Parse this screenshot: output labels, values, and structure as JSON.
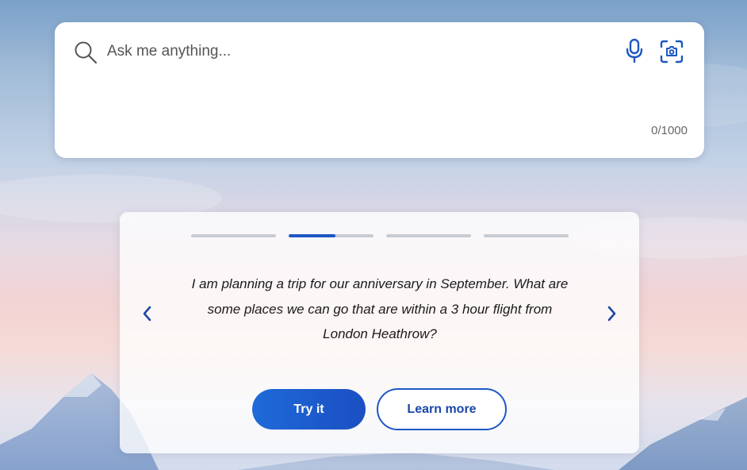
{
  "search": {
    "placeholder": "Ask me anything...",
    "value": "",
    "counter": "0/1000"
  },
  "suggestion": {
    "active_slide": 2,
    "slide_count": 4,
    "active_progress": 0.55,
    "prompt": "I am planning a trip for our anniversary in September. What are some places we can go that are within a 3 hour flight from London Heathrow?",
    "try_label": "Try it",
    "learn_label": "Learn more"
  },
  "icons": {
    "search": "search-icon",
    "microphone": "microphone-icon",
    "visual_search": "camera-scan-icon",
    "prev": "chevron-left-icon",
    "next": "chevron-right-icon"
  },
  "colors": {
    "accent": "#1d57c4",
    "track": "#c9cbd2",
    "button_gradient_start": "#1f6ad9",
    "button_gradient_end": "#1a4fc2"
  }
}
